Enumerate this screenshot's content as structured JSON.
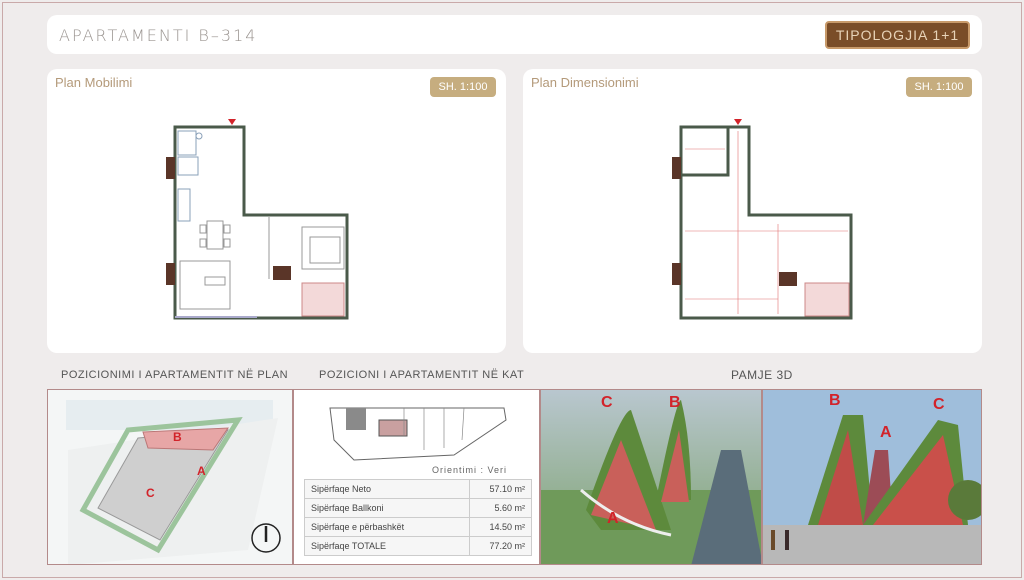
{
  "header": {
    "title": "APARTAMENTI B–314",
    "typology": "TIPOLOGJIA 1+1"
  },
  "plans": [
    {
      "title": "Plan Mobilimi",
      "scale": "SH. 1:100"
    },
    {
      "title": "Plan Dimensionimi",
      "scale": "SH. 1:100"
    }
  ],
  "sections": {
    "position_plan": "POZICIONIMI I APARTAMENTIT NË PLAN",
    "position_floor": "POZICIONI I APARTAMENTIT NË KAT",
    "view3d": "PAMJE 3D"
  },
  "orientation": {
    "label": "Orientimi :",
    "value": "Veri"
  },
  "areas": [
    {
      "name": "Sipërfaqe Neto",
      "value": "57.10",
      "unit": "m²"
    },
    {
      "name": "Sipërfaqe Ballkoni",
      "value": "5.60",
      "unit": "m²"
    },
    {
      "name": "Sipërfaqe e përbashkët",
      "value": "14.50",
      "unit": "m²"
    },
    {
      "name": "Sipërfaqe TOTALE",
      "value": "77.20",
      "unit": "m²"
    }
  ],
  "site_labels": {
    "a": "A",
    "b": "B",
    "c": "C"
  },
  "render_labels": {
    "a": "A",
    "b": "B",
    "c": "C"
  },
  "colors": {
    "accent": "#7a4d28",
    "scale_badge": "#c6ad7f",
    "wall": "#4a5a4a",
    "marker": "#d2232a"
  }
}
